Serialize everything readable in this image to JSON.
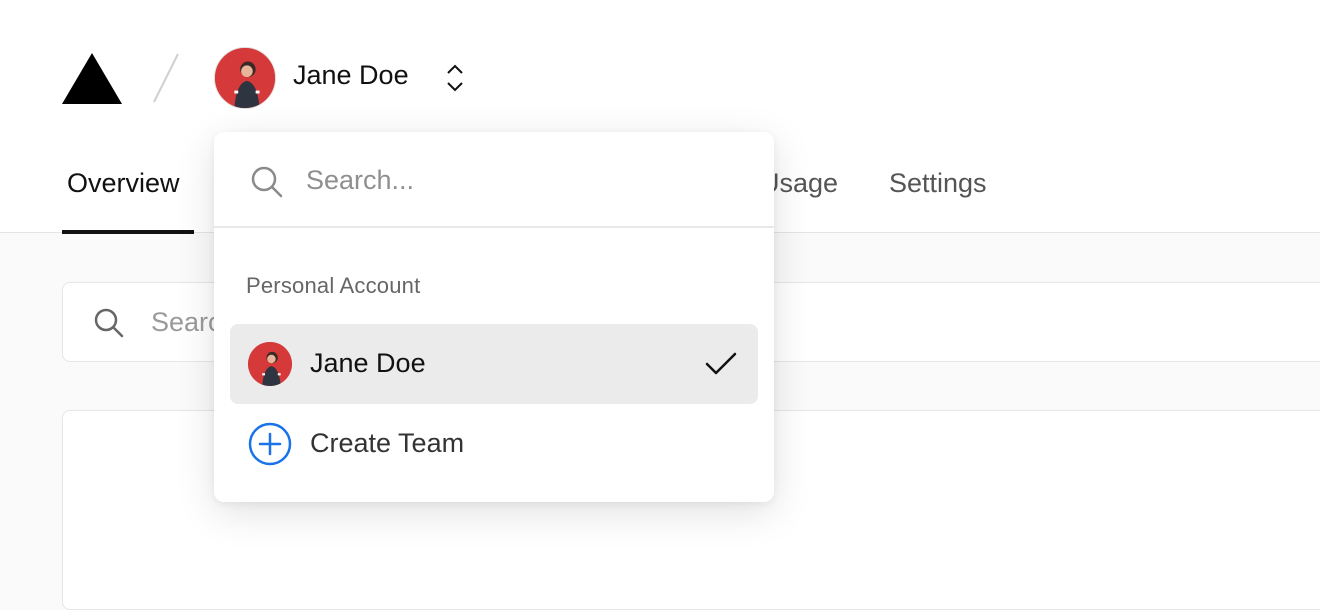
{
  "header": {
    "account_name": "Jane Doe",
    "tabs": [
      {
        "label": "Overview",
        "active": true
      },
      {
        "label": "Usage",
        "active": false
      },
      {
        "label": "Settings",
        "active": false
      }
    ]
  },
  "page_search": {
    "placeholder": "Search..."
  },
  "dropdown": {
    "search_placeholder": "Search...",
    "section_label": "Personal Account",
    "items": [
      {
        "label": "Jane Doe",
        "selected": true,
        "icon": "avatar"
      },
      {
        "label": "Create Team",
        "selected": false,
        "icon": "plus-circle-icon"
      }
    ]
  },
  "colors": {
    "avatar_bg": "#d6393a",
    "accent_blue": "#1a73e8",
    "selected_bg": "#ebebeb"
  },
  "icons": [
    "logo-triangle-icon",
    "slash-separator-icon",
    "chevron-up-down-icon",
    "search-icon",
    "check-icon",
    "plus-circle-icon"
  ]
}
